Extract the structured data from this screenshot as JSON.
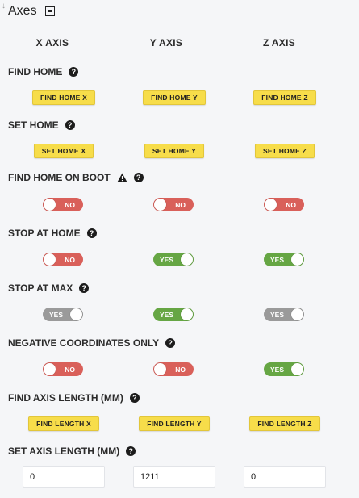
{
  "panel": {
    "title": "Axes",
    "corner_mark": "↓"
  },
  "columns": [
    "X AXIS",
    "Y AXIS",
    "Z AXIS"
  ],
  "sections": {
    "find_home": {
      "label": "FIND HOME",
      "buttons": [
        "FIND HOME X",
        "FIND HOME Y",
        "FIND HOME Z"
      ]
    },
    "set_home": {
      "label": "SET HOME",
      "buttons": [
        "SET HOME X",
        "SET HOME Y",
        "SET HOME Z"
      ]
    },
    "find_home_on_boot": {
      "label": "FIND HOME ON BOOT",
      "toggles": [
        {
          "text": "NO",
          "state": "off"
        },
        {
          "text": "NO",
          "state": "off"
        },
        {
          "text": "NO",
          "state": "off"
        }
      ]
    },
    "stop_at_home": {
      "label": "STOP AT HOME",
      "toggles": [
        {
          "text": "NO",
          "state": "off"
        },
        {
          "text": "YES",
          "state": "on"
        },
        {
          "text": "YES",
          "state": "on"
        }
      ]
    },
    "stop_at_max": {
      "label": "STOP AT MAX",
      "toggles": [
        {
          "text": "YES",
          "state": "disabled"
        },
        {
          "text": "YES",
          "state": "on"
        },
        {
          "text": "YES",
          "state": "disabled"
        }
      ]
    },
    "negative_coordinates_only": {
      "label": "NEGATIVE COORDINATES ONLY",
      "toggles": [
        {
          "text": "NO",
          "state": "off"
        },
        {
          "text": "NO",
          "state": "off"
        },
        {
          "text": "YES",
          "state": "on"
        }
      ]
    },
    "find_axis_length": {
      "label": "FIND AXIS LENGTH (MM)",
      "buttons": [
        "FIND LENGTH X",
        "FIND LENGTH Y",
        "FIND LENGTH Z"
      ]
    },
    "set_axis_length": {
      "label": "SET AXIS LENGTH (MM)",
      "values": [
        "0",
        "1211",
        "0"
      ]
    }
  },
  "icons": {
    "help": "question-circle-icon",
    "warning": "warning-triangle-icon",
    "collapse": "collapse-minus-icon"
  },
  "colors": {
    "yellow_button": "#f7dd4a",
    "toggle_off": "#d9605a",
    "toggle_on": "#66a644",
    "toggle_disabled": "#9a9a9a",
    "background": "#f5f6f8"
  }
}
